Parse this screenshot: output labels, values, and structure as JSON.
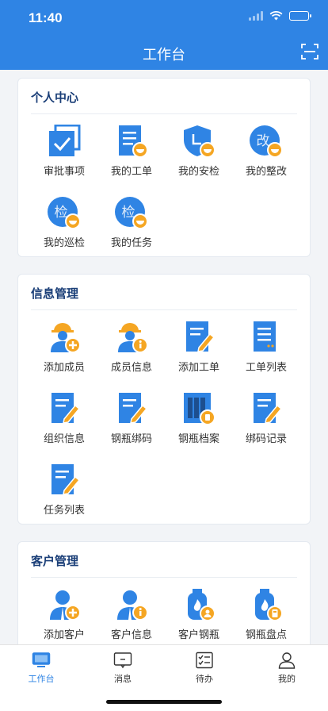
{
  "status": {
    "time": "11:40"
  },
  "header": {
    "title": "工作台"
  },
  "colors": {
    "primary": "#2f84e4",
    "accent": "#f5a623",
    "badge": "#f5a623"
  },
  "sections": {
    "personal": {
      "title": "个人中心",
      "items": [
        {
          "label": "审批事项",
          "icon": "approval-icon"
        },
        {
          "label": "我的工单",
          "icon": "work-order-icon"
        },
        {
          "label": "我的安检",
          "icon": "safety-check-icon"
        },
        {
          "label": "我的整改",
          "icon": "rectification-icon",
          "glyph": "改"
        },
        {
          "label": "我的巡检",
          "icon": "patrol-icon",
          "glyph": "检"
        },
        {
          "label": "我的任务",
          "icon": "task-icon",
          "glyph": "检"
        }
      ]
    },
    "info": {
      "title": "信息管理",
      "items": [
        {
          "label": "添加成员",
          "icon": "add-member-icon"
        },
        {
          "label": "成员信息",
          "icon": "member-info-icon"
        },
        {
          "label": "添加工单",
          "icon": "add-order-icon"
        },
        {
          "label": "工单列表",
          "icon": "order-list-icon"
        },
        {
          "label": "组织信息",
          "icon": "org-info-icon"
        },
        {
          "label": "钢瓶绑码",
          "icon": "cylinder-bind-icon"
        },
        {
          "label": "钢瓶档案",
          "icon": "cylinder-archive-icon"
        },
        {
          "label": "绑码记录",
          "icon": "bind-record-icon"
        },
        {
          "label": "任务列表",
          "icon": "task-list-icon"
        }
      ]
    },
    "customer": {
      "title": "客户管理",
      "items": [
        {
          "label": "添加客户",
          "icon": "add-customer-icon"
        },
        {
          "label": "客户信息",
          "icon": "customer-info-icon"
        },
        {
          "label": "客户钢瓶",
          "icon": "customer-cylinder-icon"
        },
        {
          "label": "钢瓶盘点",
          "icon": "cylinder-inventory-icon"
        }
      ]
    }
  },
  "tabbar": {
    "items": [
      {
        "label": "工作台",
        "icon": "workbench-icon",
        "active": true
      },
      {
        "label": "消息",
        "icon": "message-icon"
      },
      {
        "label": "待办",
        "icon": "todo-icon"
      },
      {
        "label": "我的",
        "icon": "profile-icon"
      }
    ]
  }
}
